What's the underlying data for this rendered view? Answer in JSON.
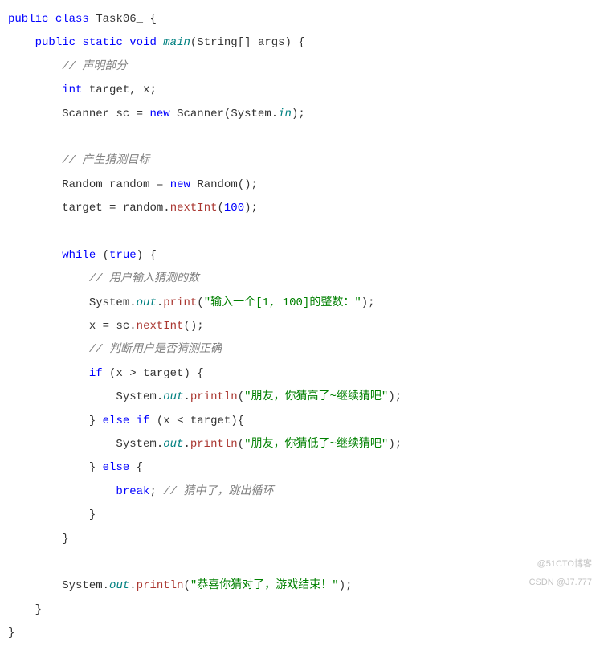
{
  "lines": {
    "l1a": "public",
    "l1b": "class",
    "l1c": "Task06_",
    "l1d": "{",
    "l2a": "public",
    "l2b": "static",
    "l2c": "void",
    "l2d": "main",
    "l2e": "(",
    "l2f": "String",
    "l2g": "[]",
    "l2h": "args",
    "l2i": ") {",
    "l3": "// 声明部分",
    "l4a": "int",
    "l4b": "target",
    "l4c": ",",
    "l4d": "x",
    "l4e": ";",
    "l5a": "Scanner",
    "l5b": "sc",
    "l5c": "=",
    "l5d": "new",
    "l5e": "Scanner",
    "l5f": "(",
    "l5g": "System",
    "l5h": ".",
    "l5i": "in",
    "l5j": ");",
    "l6": "",
    "l7": "// 产生猜测目标",
    "l8a": "Random",
    "l8b": "random",
    "l8c": "=",
    "l8d": "new",
    "l8e": "Random",
    "l8f": "();",
    "l9a": "target",
    "l9b": "=",
    "l9c": "random",
    "l9d": ".",
    "l9e": "nextInt",
    "l9f": "(",
    "l9g": "100",
    "l9h": ");",
    "l10": "",
    "l11a": "while",
    "l11b": "(",
    "l11c": "true",
    "l11d": ") {",
    "l12": "// 用户输入猜测的数",
    "l13a": "System",
    "l13b": ".",
    "l13c": "out",
    "l13d": ".",
    "l13e": "print",
    "l13f": "(",
    "l13g": "\"输入一个[1, 100]的整数：\"",
    "l13h": ");",
    "l14a": "x",
    "l14b": "=",
    "l14c": "sc",
    "l14d": ".",
    "l14e": "nextInt",
    "l14f": "();",
    "l15": "// 判断用户是否猜测正确",
    "l16a": "if",
    "l16b": "(",
    "l16c": "x",
    "l16d": ">",
    "l16e": "target",
    "l16f": ") {",
    "l17a": "System",
    "l17b": ".",
    "l17c": "out",
    "l17d": ".",
    "l17e": "println",
    "l17f": "(",
    "l17g": "\"朋友，你猜高了~继续猜吧\"",
    "l17h": ");",
    "l18a": "}",
    "l18b": "else",
    "l18c": "if",
    "l18d": "(",
    "l18e": "x",
    "l18f": "<",
    "l18g": "target",
    "l18h": "){",
    "l19a": "System",
    "l19b": ".",
    "l19c": "out",
    "l19d": ".",
    "l19e": "println",
    "l19f": "(",
    "l19g": "\"朋友，你猜低了~继续猜吧\"",
    "l19h": ");",
    "l20a": "}",
    "l20b": "else",
    "l20c": "{",
    "l21a": "break",
    "l21b": ";",
    "l21c": "// 猜中了，跳出循环",
    "l22": "}",
    "l23": "}",
    "l24": "",
    "l25a": "System",
    "l25b": ".",
    "l25c": "out",
    "l25d": ".",
    "l25e": "println",
    "l25f": "(",
    "l25g": "\"恭喜你猜对了，游戏结束！\"",
    "l25h": ");",
    "l26": "}",
    "l27": "}"
  },
  "watermark_left": "CSDN",
  "watermark_right": "@J7.777",
  "watermark_top": "@51CTO博客"
}
